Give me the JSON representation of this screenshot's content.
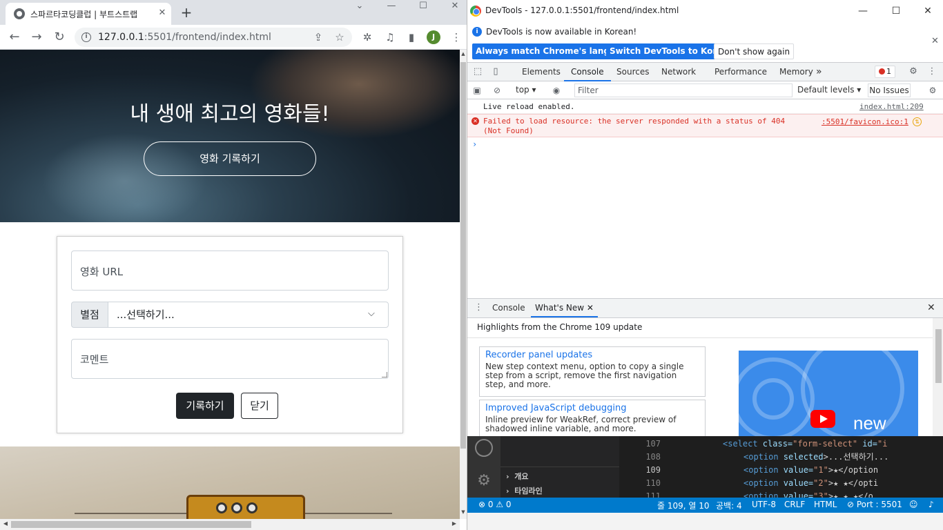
{
  "browser": {
    "tab_title": "스파르타코딩클럽 | 부트스트랩",
    "tab_close": "✕",
    "new_tab": "+",
    "url_host": "127.0.0.1",
    "url_rest": ":5501/frontend/index.html",
    "profile_initial": "J",
    "icons": [
      "back-arrow-icon",
      "forward-arrow-icon",
      "reload-icon",
      "info-icon",
      "share-icon",
      "star-icon",
      "extensions-icon",
      "media-icon",
      "sidepanel-icon",
      "more-icon"
    ]
  },
  "page": {
    "hero_title": "내 생애 최고의 영화들!",
    "hero_button": "영화 기록하기",
    "url_placeholder": "영화 URL",
    "rating_label": "별점",
    "rating_selected": "...선택하기...",
    "comment_placeholder": "코멘트",
    "save_button": "기록하기",
    "close_button": "닫기"
  },
  "devtools": {
    "window_title": "DevTools - 127.0.0.1:5501/frontend/index.html",
    "infobar_message": "DevTools is now available in Korean!",
    "infobar_buttons": [
      "Always match Chrome's language",
      "Switch DevTools to Korean",
      "Don't show again"
    ],
    "tabs": [
      "Elements",
      "Console",
      "Sources",
      "Network",
      "Performance",
      "Memory"
    ],
    "active_tab": "Console",
    "more_tabs": "»",
    "error_count": "1",
    "context": "top",
    "filter_placeholder": "Filter",
    "levels": "Default levels ▾",
    "issues": "No Issues",
    "messages": [
      {
        "text": "Live reload enabled.",
        "source": "index.html:209",
        "type": "log"
      },
      {
        "text": "Failed to load resource: the server responded with a status of 404 (Not Found)",
        "source": ":5501/favicon.ico:1",
        "type": "error"
      }
    ],
    "drawer_tabs": [
      "Console",
      "What's New"
    ],
    "drawer_active": "What's New",
    "highlights": "Highlights from the Chrome 109 update",
    "news": [
      {
        "title": "Recorder panel updates",
        "desc": "New step context menu, option to copy a single step from a script, remove the first navigation step, and more."
      },
      {
        "title": "Improved JavaScript debugging",
        "desc": "Inline preview for WeakRef, correct preview of shadowed inline variable, and more."
      }
    ],
    "video_word": "new",
    "accent": "#1a73e8",
    "error_color": "#d93025"
  },
  "vscode": {
    "sidebar_items": [
      "개요",
      "타임라인"
    ],
    "line_numbers": [
      "107",
      "108",
      "109",
      "110",
      "111"
    ],
    "current_line": "109",
    "code": [
      {
        "tag": "<select",
        "attr1": " class=",
        "val1": "\"form-select\"",
        "attr2": " id=",
        "val2": "\"i"
      },
      {
        "tag": "<option",
        "attr1": " selected",
        "rest": ">...선택하기..."
      },
      {
        "tag": "<option",
        "attr1": " value=",
        "val1": "\"1\"",
        "rest": ">★</option"
      },
      {
        "tag": "<option",
        "attr1": " value=",
        "val1": "\"2\"",
        "rest": ">★ ★</opti"
      },
      {
        "tag": "<option",
        "attr1": " value=",
        "val1": "\"3\"",
        "rest": ">★ ★ ★</o"
      }
    ],
    "status_left": "⊗ 0 ⚠ 0",
    "status_items": [
      "줄 109, 열 10",
      "공백: 4",
      "UTF-8",
      "CRLF",
      "HTML",
      "⊘ Port : 5501"
    ],
    "status_color": "#007acc"
  }
}
